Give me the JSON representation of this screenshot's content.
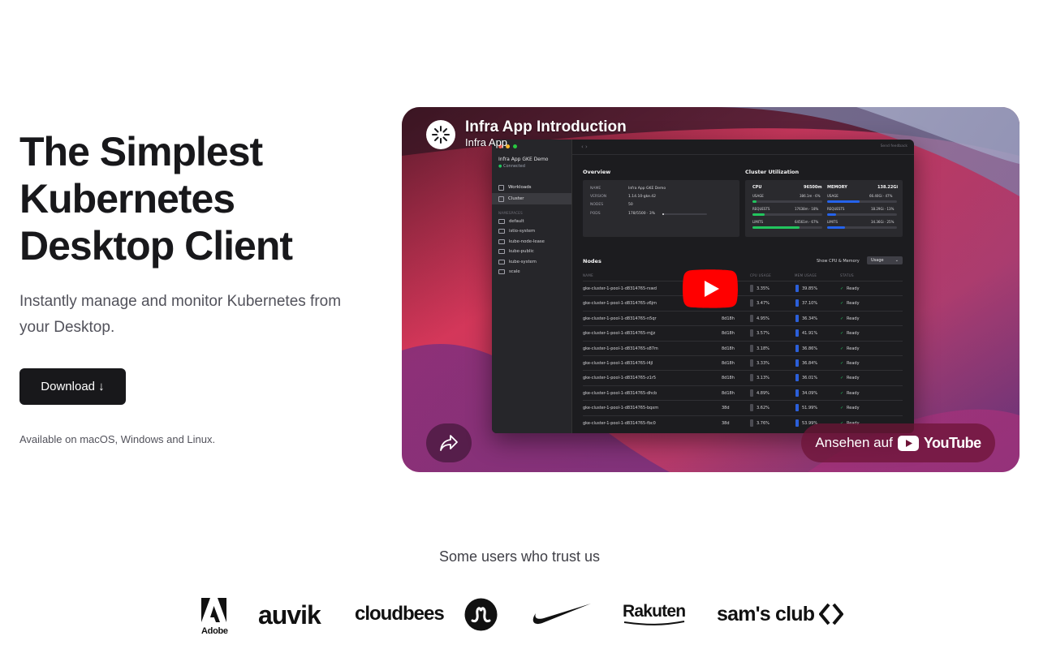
{
  "hero": {
    "title_lines": [
      "The Simplest",
      "Kubernetes",
      "Desktop Client"
    ],
    "subtitle": "Instantly manage and monitor Kubernetes from your Desktop.",
    "download_label": "Download ↓",
    "availability": "Available on macOS, Windows and Linux."
  },
  "video": {
    "title": "Infra App Introduction",
    "channel": "Infra App",
    "watch_label": "Ansehen auf",
    "watch_brand": "YouTube",
    "icons": [
      "infra-app-logo-icon",
      "share-icon",
      "play-icon",
      "youtube-logo-icon"
    ],
    "colors": {
      "play_red": "#ff0000",
      "watch_bg": "#6e1437"
    }
  },
  "app": {
    "cluster_name": "Infra App GKE Demo",
    "cluster_status": "Connected",
    "sidebar": [
      {
        "label": "Workloads",
        "active": false
      },
      {
        "label": "Cluster",
        "active": true
      }
    ],
    "namespaces_heading": "NAMESPACES",
    "namespaces": [
      "default",
      "istio-system",
      "kube-node-lease",
      "kube-public",
      "kube-system",
      "scale"
    ],
    "feedback": "Send feedback",
    "overview": {
      "title": "Overview",
      "rows": [
        {
          "k": "NAME",
          "v": "Infra App GKE Demo"
        },
        {
          "k": "VERSION",
          "v": "1.14.10-gke.42"
        },
        {
          "k": "NODES",
          "v": "50"
        },
        {
          "k": "PODS",
          "v": "178/5500 · 3%"
        }
      ]
    },
    "utilization": {
      "title": "Cluster Utilization",
      "cpu": {
        "label": "CPU",
        "total": "96500m",
        "usage": "386.1m · 6%",
        "requests": "17638m · 18%",
        "limits": "64561m · 67%"
      },
      "memory": {
        "label": "MEMORY",
        "total": "138.22Gi",
        "usage": "66.40Gi · 47%",
        "requests": "18.29Gi · 13%",
        "limits": "34.36Gi · 25%"
      },
      "usage_label": "USAGE",
      "requests_label": "REQUESTS",
      "limits_label": "LIMITS"
    },
    "nodes": {
      "title": "Nodes",
      "show_label": "Show CPU & Memory",
      "select_value": "Usage",
      "columns": [
        "NAME",
        "CPU USAGE",
        "MEM USAGE",
        "STATUS"
      ],
      "rows": [
        {
          "name": "gke-cluster-1-pool-1-d8314765-rswd",
          "age": "",
          "cpu": "3.35%",
          "mem": "39.85%",
          "status": "Ready"
        },
        {
          "name": "gke-cluster-1-pool-1-d8314765-z6jm",
          "age": "",
          "cpu": "3.47%",
          "mem": "37.10%",
          "status": "Ready"
        },
        {
          "name": "gke-cluster-1-pool-1-d8314765-n5qr",
          "age": "8d18h",
          "cpu": "4.95%",
          "mem": "36.34%",
          "status": "Ready"
        },
        {
          "name": "gke-cluster-1-pool-1-d8314765-mjjz",
          "age": "8d18h",
          "cpu": "3.57%",
          "mem": "41.91%",
          "status": "Ready"
        },
        {
          "name": "gke-cluster-1-pool-1-d8314765-s87m",
          "age": "8d18h",
          "cpu": "3.18%",
          "mem": "36.86%",
          "status": "Ready"
        },
        {
          "name": "gke-cluster-1-pool-1-d8314765-l4jl",
          "age": "8d18h",
          "cpu": "3.33%",
          "mem": "36.84%",
          "status": "Ready"
        },
        {
          "name": "gke-cluster-1-pool-1-d8314765-z1r5",
          "age": "8d18h",
          "cpu": "3.13%",
          "mem": "36.01%",
          "status": "Ready"
        },
        {
          "name": "gke-cluster-1-pool-1-d8314765-dhcb",
          "age": "8d18h",
          "cpu": "4.89%",
          "mem": "34.09%",
          "status": "Ready"
        },
        {
          "name": "gke-cluster-1-pool-1-d8314765-bqxm",
          "age": "38d",
          "cpu": "3.62%",
          "mem": "51.99%",
          "status": "Ready"
        },
        {
          "name": "gke-cluster-1-pool-1-d8314765-fbc0",
          "age": "38d",
          "cpu": "3.76%",
          "mem": "53.99%",
          "status": "Ready"
        }
      ]
    }
  },
  "trust": {
    "title": "Some users who trust us",
    "logos": [
      {
        "name": "adobe",
        "text": "Adobe"
      },
      {
        "name": "auvik",
        "text": "auvik"
      },
      {
        "name": "cloudbees",
        "text": "cloudbees"
      },
      {
        "name": "lululemon",
        "text": ""
      },
      {
        "name": "nike",
        "text": ""
      },
      {
        "name": "rakuten",
        "text": "Rakuten"
      },
      {
        "name": "sams-club",
        "text": "sam's club"
      }
    ]
  }
}
